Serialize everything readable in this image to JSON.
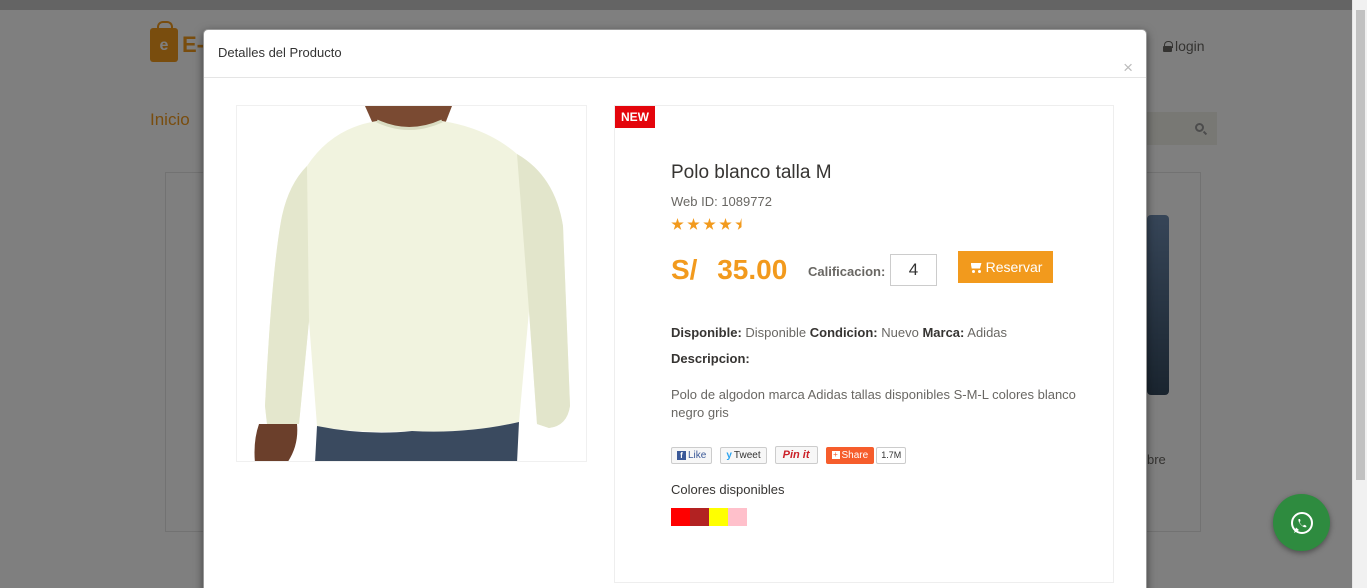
{
  "background": {
    "logo_text": "E-S",
    "login_label": "login",
    "nav_home": "Inicio",
    "card_text": "bre"
  },
  "modal": {
    "title": "Detalles del Producto",
    "close_label": "×"
  },
  "product": {
    "badge": "NEW",
    "name": "Polo blanco talla M",
    "web_id": "Web ID: 1089772",
    "rating_stars": 4.5,
    "price": "S/  35.00",
    "calificacion_label": "Calificacion:",
    "calificacion_value": "4",
    "reserve_label": "Reservar",
    "disponible_label": "Disponible:",
    "disponible_value": "Disponible",
    "condicion_label": "Condicion:",
    "condicion_value": "Nuevo",
    "marca_label": "Marca:",
    "marca_value": "Adidas",
    "descripcion_label": "Descripcion:",
    "descripcion_text": "Polo de algodon marca Adidas tallas disponibles S-M-L colores blanco negro gris",
    "colors_label": "Colores disponibles",
    "colors": [
      "#ff0000",
      "#b22222",
      "#ffff00",
      "#ffc0cb"
    ]
  },
  "share": {
    "like": "Like",
    "tweet": "Tweet",
    "pin": "Pin it",
    "share": "Share",
    "count": "1.7M"
  },
  "icons": {
    "whatsapp": "whatsapp-icon",
    "cart": "cart-icon",
    "lock": "lock-icon",
    "search": "search-icon"
  },
  "colors": {
    "accent": "#f29a1d",
    "badge": "#e4050c",
    "whatsapp": "#2e8b3f"
  }
}
